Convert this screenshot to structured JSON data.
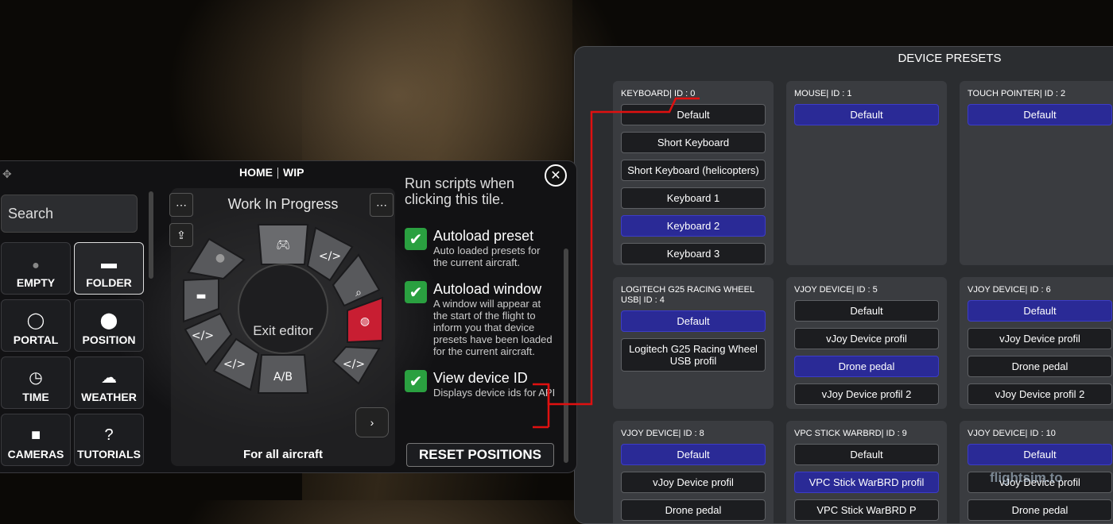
{
  "presets": {
    "title": "DEVICE PRESETS",
    "devices": [
      {
        "name": "KEYBOARD| ID : 0",
        "presets": [
          "Default",
          "Short Keyboard",
          "Short Keyboard (helicopters)",
          "Keyboard 1",
          "Keyboard 2",
          "Keyboard 3"
        ],
        "selected": 4
      },
      {
        "name": "MOUSE| ID : 1",
        "presets": [
          "Default"
        ],
        "selected": 0
      },
      {
        "name": "TOUCH POINTER| ID : 2",
        "presets": [
          "Default"
        ],
        "selected": 0
      },
      {
        "name": "LOGITECH G25 RACING WHEEL USB| ID : 4",
        "presets": [
          "Default",
          "Logitech G25 Racing Wheel USB profil"
        ],
        "selected": 0
      },
      {
        "name": "VJOY DEVICE| ID : 5",
        "presets": [
          "Default",
          "vJoy Device profil",
          "Drone pedal",
          "vJoy Device profil 2"
        ],
        "selected": 2
      },
      {
        "name": "VJOY DEVICE| ID : 6",
        "presets": [
          "Default",
          "vJoy Device profil",
          "Drone pedal",
          "vJoy Device profil 2"
        ],
        "selected": 0
      },
      {
        "name": "VJOY DEVICE| ID : 8",
        "presets": [
          "Default",
          "vJoy Device profil",
          "Drone pedal"
        ],
        "selected": 0
      },
      {
        "name": "VPC STICK WARBRD| ID : 9",
        "presets": [
          "Default",
          "VPC Stick WarBRD profil",
          "VPC Stick WarBRD P"
        ],
        "selected": 1
      },
      {
        "name": "VJOY DEVICE| ID : 10",
        "presets": [
          "Default",
          "vJoy Device profil",
          "Drone pedal"
        ],
        "selected": 0
      }
    ]
  },
  "editor": {
    "tabs": [
      "HOME",
      "WIP"
    ],
    "close_icon": "close-icon",
    "search_placeholder": "Search",
    "tiles": [
      {
        "label": "EMPTY",
        "icon": "●"
      },
      {
        "label": "FOLDER",
        "icon": "▬"
      },
      {
        "label": "PORTAL",
        "icon": "◯"
      },
      {
        "label": "POSITION",
        "icon": "⬤"
      },
      {
        "label": "TIME",
        "icon": "◷"
      },
      {
        "label": "WEATHER",
        "icon": "☁"
      },
      {
        "label": "CAMERAS",
        "icon": "■"
      },
      {
        "label": "TUTORIALS",
        "icon": "?"
      }
    ],
    "wheel": {
      "title": "Work In Progress",
      "center": "Exit editor",
      "footer": "For all aircraft"
    },
    "options": {
      "clipped_text": "Run scripts when clicking this tile.",
      "items": [
        {
          "title": "Autoload preset",
          "desc": "Auto loaded presets for the current aircraft."
        },
        {
          "title": "Autoload window",
          "desc": "A window will appear at the start of the flight to inform you that device presets have been loaded for the current aircraft."
        },
        {
          "title": "View device ID",
          "desc": "Displays device ids for API"
        }
      ],
      "reset": "RESET POSITIONS"
    }
  },
  "watermark": "flightsim.to",
  "colors": {
    "selected": "#2a2a96",
    "check": "#2aa040",
    "highlight": "#d0202e",
    "annotation": "#e01010"
  }
}
